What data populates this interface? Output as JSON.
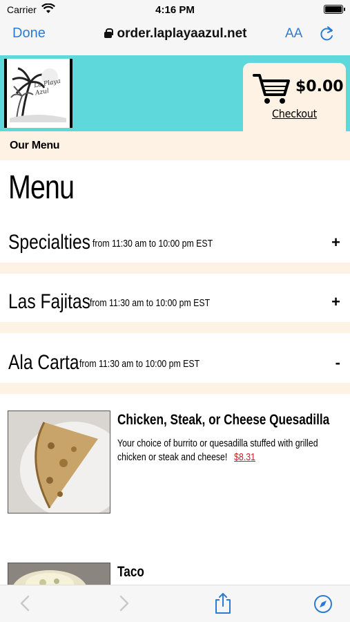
{
  "status": {
    "carrier": "Carrier",
    "time": "4:16 PM"
  },
  "browser": {
    "done_label": "Done",
    "url": "order.laplayaazul.net",
    "text_size_label": "AA"
  },
  "site": {
    "logo_text": "La Playa Azul",
    "cart_total": "$0.00",
    "checkout_label": "Checkout",
    "nav_label": "Our Menu"
  },
  "menu": {
    "title": "Menu",
    "categories": [
      {
        "name": "Specialties",
        "hours": "from 11:30 am to 10:00 pm EST",
        "toggle": "+"
      },
      {
        "name": "Las Fajitas",
        "hours": "from 11:30 am to 10:00 pm EST",
        "toggle": "+"
      },
      {
        "name": "Ala Carta",
        "hours": "from 11:30 am to 10:00 pm EST",
        "toggle": "-"
      }
    ],
    "items": [
      {
        "title": "Chicken, Steak, or Cheese Quesadilla",
        "description": "Your choice of burrito or quesadilla stuffed with grilled chicken or steak and cheese!",
        "price": "$8.31"
      },
      {
        "title": "Taco"
      }
    ]
  },
  "colors": {
    "header_teal": "#5fd8dc",
    "cream": "#fdf2e4",
    "link_blue": "#2b7bd4",
    "price_red": "#c8222c"
  },
  "icons": [
    "wifi-icon",
    "battery-icon",
    "lock-icon",
    "reload-icon",
    "cart-icon",
    "back-icon",
    "forward-icon",
    "share-icon",
    "compass-icon"
  ]
}
